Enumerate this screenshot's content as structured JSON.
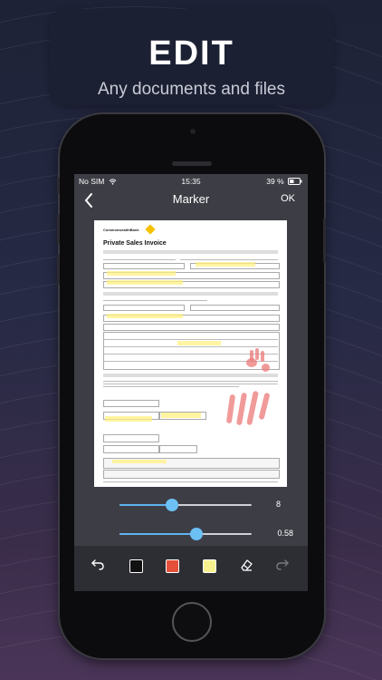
{
  "banner": {
    "title": "EDIT",
    "subtitle": "Any documents and files"
  },
  "status_bar": {
    "carrier": "No SIM",
    "time": "15:35",
    "battery": "39 %"
  },
  "nav": {
    "title": "Marker",
    "ok_label": "OK"
  },
  "document": {
    "brand": "CommonwealthBank",
    "title": "Private Sales Invoice"
  },
  "sliders": [
    {
      "name": "size",
      "value": 8,
      "label": "8",
      "max": 20
    },
    {
      "name": "opacity",
      "value": 0.58,
      "label": "0.58",
      "max": 1
    }
  ],
  "toolbar": {
    "tools": [
      {
        "name": "undo-icon"
      },
      {
        "name": "color-black",
        "color": "#111111"
      },
      {
        "name": "color-red",
        "color": "#e4503a"
      },
      {
        "name": "color-yellow",
        "color": "#f7f08f"
      },
      {
        "name": "eraser-icon"
      },
      {
        "name": "redo-icon"
      }
    ],
    "selected_color": "#f7f08f"
  },
  "colors": {
    "accent": "#6cc0f4",
    "screen_bg": "#3d3d46",
    "toolbar_bg": "#2d2d34"
  }
}
